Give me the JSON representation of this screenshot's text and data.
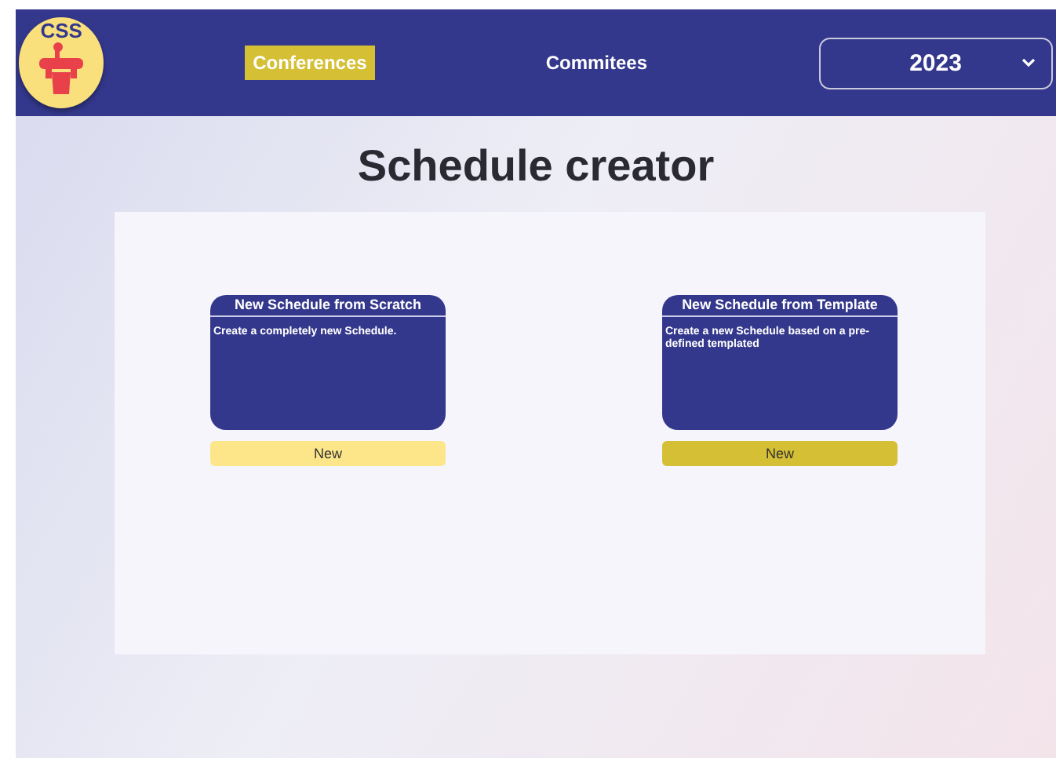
{
  "header": {
    "logo_text": "CSS",
    "nav": [
      {
        "label": "Conferences",
        "selected": true
      },
      {
        "label": "Commitees",
        "selected": false
      }
    ],
    "year_select": {
      "value": "2023"
    }
  },
  "title": "Schedule creator",
  "cards": [
    {
      "title": "New Schedule from Scratch",
      "description": "Create a completely new Schedule.",
      "button": "New",
      "selected": false
    },
    {
      "title": "New Schedule from Template",
      "description": "Create a new Schedule based on a pre-defined templated",
      "button": "New",
      "selected": true
    }
  ]
}
